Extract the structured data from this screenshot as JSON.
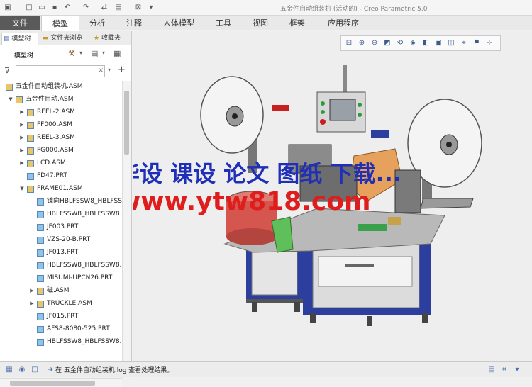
{
  "window": {
    "title": "五金件自动组装机 (活动的) - Creo Parametric 5.0"
  },
  "ribbon": {
    "tabs": [
      {
        "label": "文件"
      },
      {
        "label": "模型"
      },
      {
        "label": "分析"
      },
      {
        "label": "注释"
      },
      {
        "label": "人体模型"
      },
      {
        "label": "工具"
      },
      {
        "label": "视图"
      },
      {
        "label": "框架"
      },
      {
        "label": "应用程序"
      }
    ]
  },
  "panel": {
    "tabs": [
      {
        "label": "模型树"
      },
      {
        "label": "文件夹浏览"
      },
      {
        "label": "收藏夹"
      }
    ],
    "tree_header": "模型树",
    "filter_placeholder": ""
  },
  "tree": {
    "rows": [
      {
        "label": "五金件自动组装机.ASM",
        "type": "asm",
        "indent": 0,
        "expander": ""
      },
      {
        "label": "五金件自动.ASM",
        "type": "asm",
        "indent": 1,
        "expander": "▼"
      },
      {
        "label": "REEL-2.ASM",
        "type": "asm",
        "indent": 2,
        "expander": "▶"
      },
      {
        "label": "FF000.ASM",
        "type": "asm",
        "indent": 2,
        "expander": "▶"
      },
      {
        "label": "REEL-3.ASM",
        "type": "asm",
        "indent": 2,
        "expander": "▶"
      },
      {
        "label": "FG000.ASM",
        "type": "asm",
        "indent": 2,
        "expander": "▶"
      },
      {
        "label": "LCD.ASM",
        "type": "asm",
        "indent": 2,
        "expander": "▶"
      },
      {
        "label": "FD47.PRT",
        "type": "part",
        "indent": 2,
        "expander": ""
      },
      {
        "label": "FRAME01.ASM",
        "type": "asm",
        "indent": 2,
        "expander": "▼"
      },
      {
        "label": "镜向HBLFSSW8_HBLFSS",
        "type": "part",
        "indent": 3,
        "expander": ""
      },
      {
        "label": "HBLFSSW8_HBLFSSW8.P",
        "type": "part",
        "indent": 3,
        "expander": ""
      },
      {
        "label": "JF003.PRT",
        "type": "part",
        "indent": 3,
        "expander": ""
      },
      {
        "label": "VZS-20-B.PRT",
        "type": "part",
        "indent": 3,
        "expander": ""
      },
      {
        "label": "JF013.PRT",
        "type": "part",
        "indent": 3,
        "expander": ""
      },
      {
        "label": "HBLFSSW8_HBLFSSW8.P",
        "type": "part",
        "indent": 3,
        "expander": ""
      },
      {
        "label": "MISUMI-UPCN26.PRT",
        "type": "part",
        "indent": 3,
        "expander": ""
      },
      {
        "label": "磁.ASM",
        "type": "asm",
        "indent": 3,
        "expander": "▶"
      },
      {
        "label": "TRUCKLE.ASM",
        "type": "asm",
        "indent": 3,
        "expander": "▶"
      },
      {
        "label": "JF015.PRT",
        "type": "part",
        "indent": 3,
        "expander": ""
      },
      {
        "label": "AFS8-8080-525.PRT",
        "type": "part",
        "indent": 3,
        "expander": ""
      },
      {
        "label": "HBLFSSW8_HBLFSSW8.P",
        "type": "part",
        "indent": 3,
        "expander": ""
      },
      {
        "label": "HBLFSSW8_HBLFSSW8.P",
        "type": "part",
        "indent": 3,
        "expander": ""
      }
    ]
  },
  "watermark": {
    "line1": "毕设 课设 论文 图纸 下载...",
    "line2": "www.ytw818.com"
  },
  "status": {
    "message": "在 五金件自动组装机.log 查看处理结果。"
  },
  "colors": {
    "frame_blue": "#2c3f9e",
    "panel_grey": "#c9c9c9",
    "reel_white": "#f4f4f4",
    "bin_red": "#d4564e",
    "box_orange": "#e6a15c",
    "tray_green": "#5fbf5a"
  }
}
